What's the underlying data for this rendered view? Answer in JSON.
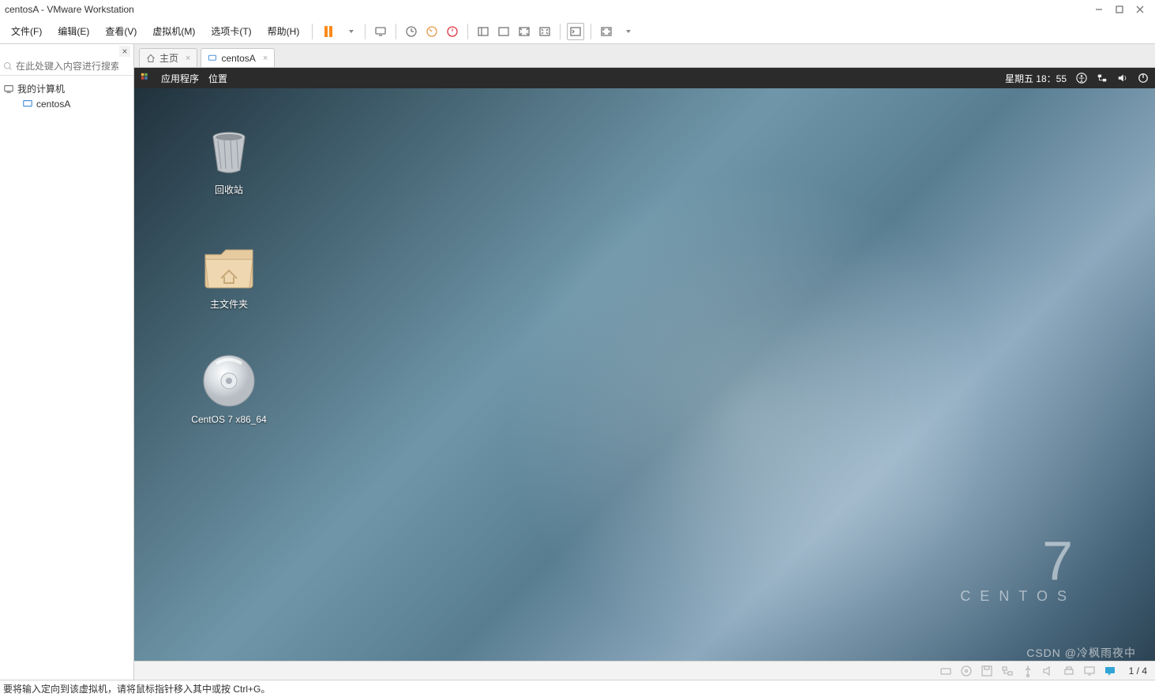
{
  "window": {
    "title": "centosA - VMware Workstation"
  },
  "menus": {
    "file": "文件(F)",
    "edit": "编辑(E)",
    "view": "查看(V)",
    "vm": "虚拟机(M)",
    "tabs": "选项卡(T)",
    "help": "帮助(H)"
  },
  "sidebar": {
    "search_placeholder": "在此处键入内容进行搜索",
    "tree": {
      "root": "我的计算机",
      "child": "centosA"
    }
  },
  "tabs": {
    "home": "主页",
    "vm": "centosA"
  },
  "gnome": {
    "apps": "应用程序",
    "places": "位置",
    "clock": "星期五 18：55"
  },
  "desktop": {
    "icons": [
      {
        "name": "trash",
        "label": "回收站"
      },
      {
        "name": "home-folder",
        "label": "主文件夹"
      },
      {
        "name": "disc",
        "label": "CentOS 7 x86_64"
      }
    ],
    "logo": {
      "version": "7",
      "name": "CENTOS"
    }
  },
  "vm_status": {
    "page": "1 / 4"
  },
  "hint": "要将输入定向到该虚拟机，请将鼠标指针移入其中或按 Ctrl+G。",
  "watermark": "CSDN @冷枫雨夜中"
}
